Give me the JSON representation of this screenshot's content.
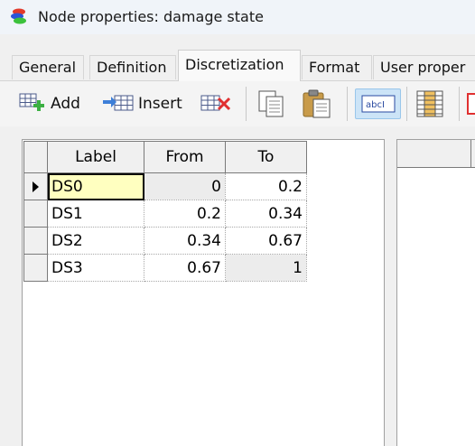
{
  "window": {
    "title": "Node properties: damage state",
    "app_icon": "stacked-layers-icon"
  },
  "tabs": [
    {
      "label": "General",
      "active": false
    },
    {
      "label": "Definition",
      "active": false
    },
    {
      "label": "Discretization",
      "active": true
    },
    {
      "label": "Format",
      "active": false
    },
    {
      "label": "User proper",
      "active": false
    }
  ],
  "toolbar": {
    "add_label": "Add",
    "add_icon": "grid-add-icon",
    "insert_label": "Insert",
    "insert_icon": "grid-insert-icon",
    "delete_icon": "grid-delete-icon",
    "copy_icon": "copy-icon",
    "paste_icon": "paste-icon",
    "text_toggle_label": "abcI",
    "text_toggle_icon": "text-field-icon",
    "column_icon": "column-chart-icon"
  },
  "grid": {
    "headers": {
      "label": "Label",
      "from": "From",
      "to": "To"
    },
    "rows": [
      {
        "label": "DS0",
        "from": "0",
        "to": "0.2"
      },
      {
        "label": "DS1",
        "from": "0.2",
        "to": "0.34"
      },
      {
        "label": "DS2",
        "from": "0.34",
        "to": "0.67"
      },
      {
        "label": "DS3",
        "from": "0.67",
        "to": "1"
      }
    ]
  },
  "colors": {
    "selected_cell": "#ffffc0",
    "toggled_button": "#cce4f7"
  }
}
